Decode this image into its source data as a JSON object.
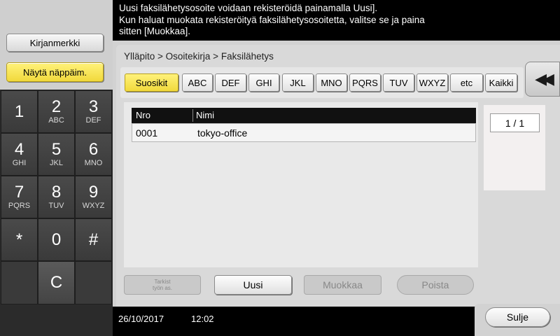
{
  "message": {
    "line1": "Uusi faksilähetysosoite voidaan rekisteröidä painamalla Uusi].",
    "line2": "Kun haluat muokata rekisteröityä faksilähetysosoitetta, valitse se ja paina",
    "line3": "sitten [Muokkaa]."
  },
  "left": {
    "bookmark_label": "Kirjanmerkki",
    "keypad_label": "Näytä näppäim."
  },
  "keypad": {
    "k1": {
      "num": "1",
      "sub": ""
    },
    "k2": {
      "num": "2",
      "sub": "ABC"
    },
    "k3": {
      "num": "3",
      "sub": "DEF"
    },
    "k4": {
      "num": "4",
      "sub": "GHI"
    },
    "k5": {
      "num": "5",
      "sub": "JKL"
    },
    "k6": {
      "num": "6",
      "sub": "MNO"
    },
    "k7": {
      "num": "7",
      "sub": "PQRS"
    },
    "k8": {
      "num": "8",
      "sub": "TUV"
    },
    "k9": {
      "num": "9",
      "sub": "WXYZ"
    },
    "star": "*",
    "k0": "0",
    "hash": "#",
    "clear": "C"
  },
  "breadcrumb": "Ylläpito > Osoitekirja > Faksilähetys",
  "tabs": [
    "Suosikit",
    "ABC",
    "DEF",
    "GHI",
    "JKL",
    "MNO",
    "PQRS",
    "TUV",
    "WXYZ",
    "etc",
    "Kaikki"
  ],
  "collapse_icon": "double-left-arrow-icon",
  "list": {
    "col_no": "Nro",
    "col_name": "Nimi",
    "rows": [
      {
        "no": "0001",
        "name": "tokyo-office"
      }
    ]
  },
  "page_indicator": "1  /  1",
  "actions": {
    "check_line1": "Tarkist",
    "check_line2": "työn as.",
    "new": "Uusi",
    "edit": "Muokkaa",
    "delete": "Poista"
  },
  "footer": {
    "date": "26/10/2017",
    "time": "12:02",
    "close": "Sulje"
  }
}
